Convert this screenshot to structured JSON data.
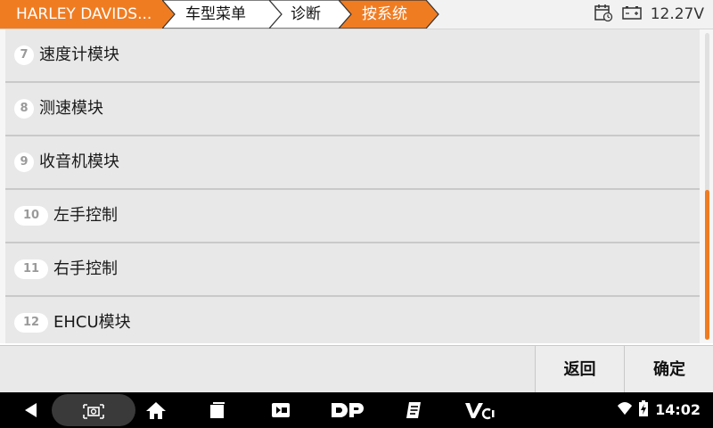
{
  "breadcrumb": {
    "items": [
      {
        "label": "HARLEY DAVIDS..."
      },
      {
        "label": "车型菜单"
      },
      {
        "label": "诊断"
      },
      {
        "label": "按系统"
      }
    ]
  },
  "status": {
    "voltage": "12.27V",
    "calendar_icon": "calendar-clock-icon",
    "battery_icon": "car-battery-icon"
  },
  "list": {
    "items": [
      {
        "number": "7",
        "label": "速度计模块"
      },
      {
        "number": "8",
        "label": "测速模块"
      },
      {
        "number": "9",
        "label": "收音机模块"
      },
      {
        "number": "10",
        "label": "左手控制"
      },
      {
        "number": "11",
        "label": "右手控制"
      },
      {
        "number": "12",
        "label": "EHCU模块"
      }
    ],
    "scroll_position": 0.5
  },
  "actions": {
    "back_label": "返回",
    "ok_label": "确定"
  },
  "system_nav": {
    "time": "14:02"
  },
  "colors": {
    "accent": "#f07c22",
    "row_bg": "#e8e8e8",
    "nav_bg": "#000000"
  }
}
